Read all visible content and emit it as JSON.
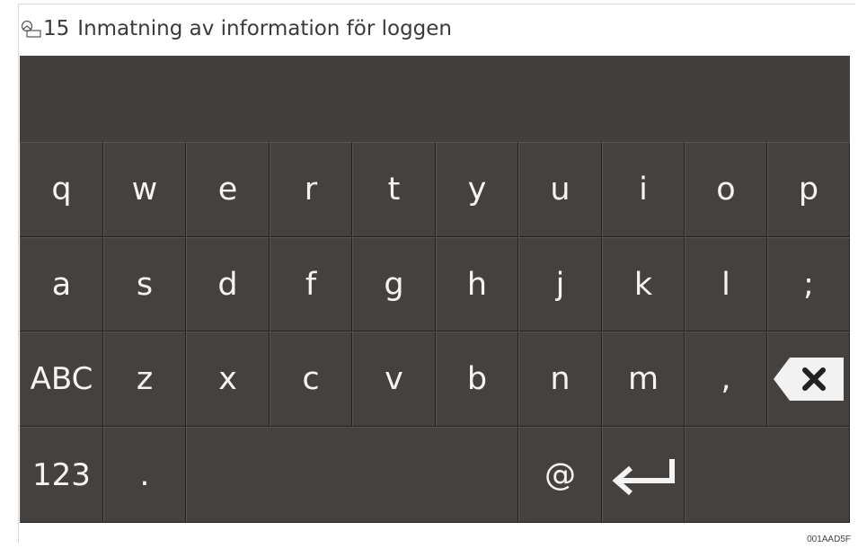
{
  "caption": {
    "icon": "figure-icon",
    "number": "15",
    "title": "Inmatning av information för loggen"
  },
  "keyboard": {
    "row1": [
      "q",
      "w",
      "e",
      "r",
      "t",
      "y",
      "u",
      "i",
      "o",
      "p"
    ],
    "row2": [
      "a",
      "s",
      "d",
      "f",
      "g",
      "h",
      "j",
      "k",
      "l",
      ";"
    ],
    "row3": [
      "ABC",
      "z",
      "x",
      "c",
      "v",
      "b",
      "n",
      "m",
      ","
    ],
    "row4": [
      "123",
      ".",
      "@"
    ],
    "backspace_icon": "backspace-icon",
    "enter_icon": "enter-arrow-icon"
  },
  "colors": {
    "screen_background": "#433f3c",
    "key_text": "#f4f4f4"
  },
  "image_code": "001AAD5F"
}
